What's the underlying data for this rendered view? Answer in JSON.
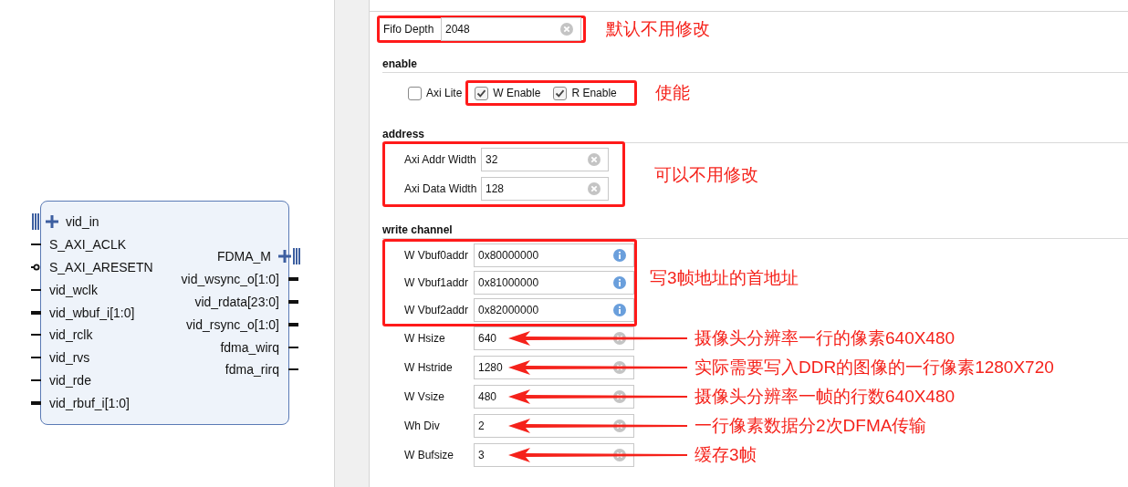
{
  "diagram": {
    "left_ports": [
      {
        "name": "vid_in",
        "kind": "interface"
      },
      {
        "name": "S_AXI_ACLK",
        "kind": "pin"
      },
      {
        "name": "S_AXI_ARESETN",
        "kind": "inverted"
      },
      {
        "name": "vid_wclk",
        "kind": "pin"
      },
      {
        "name": "vid_wbuf_i[1:0]",
        "kind": "bus"
      },
      {
        "name": "vid_rclk",
        "kind": "pin"
      },
      {
        "name": "vid_rvs",
        "kind": "pin"
      },
      {
        "name": "vid_rde",
        "kind": "pin"
      },
      {
        "name": "vid_rbuf_i[1:0]",
        "kind": "bus"
      }
    ],
    "right_ports": [
      {
        "name": "FDMA_M",
        "kind": "interface"
      },
      {
        "name": "vid_wsync_o[1:0]",
        "kind": "bus"
      },
      {
        "name": "vid_rdata[23:0]",
        "kind": "bus"
      },
      {
        "name": "vid_rsync_o[1:0]",
        "kind": "bus"
      },
      {
        "name": "fdma_wirq",
        "kind": "pin"
      },
      {
        "name": "fdma_rirq",
        "kind": "pin"
      }
    ]
  },
  "fifo": {
    "label": "Fifo Depth",
    "value": "2048",
    "kind": "clear",
    "note": "默认不用修改"
  },
  "enable": {
    "title": "enable",
    "checkboxes": [
      {
        "label": "Axi Lite",
        "checked": false
      }
    ],
    "outlined_checkboxes": [
      {
        "label": "W Enable",
        "checked": true
      },
      {
        "label": "R Enable",
        "checked": true
      }
    ],
    "note": "使能"
  },
  "address": {
    "title": "address",
    "fields": [
      {
        "label": "Axi Addr Width",
        "value": "32",
        "kind": "clear"
      },
      {
        "label": "Axi Data Width",
        "value": "128",
        "kind": "clear"
      }
    ],
    "note": "可以不用修改"
  },
  "write_channel": {
    "title": "write channel",
    "outlined_fields": [
      {
        "label": "W Vbuf0addr",
        "value": "0x80000000",
        "kind": "info"
      },
      {
        "label": "W Vbuf1addr",
        "value": "0x81000000",
        "kind": "info"
      },
      {
        "label": "W Vbuf2addr",
        "value": "0x82000000",
        "kind": "info"
      }
    ],
    "outlined_note": "写3帧地址的首地址",
    "fields": [
      {
        "label": "W Hsize",
        "value": "640",
        "kind": "clear",
        "note": "摄像头分辨率一行的像素640X480"
      },
      {
        "label": "W Hstride",
        "value": "1280",
        "kind": "clear",
        "note": "实际需要写入DDR的图像的一行像素1280X720"
      },
      {
        "label": "W Vsize",
        "value": "480",
        "kind": "clear",
        "note": "摄像头分辨率一帧的行数640X480"
      },
      {
        "label": "Wh Div",
        "value": "2",
        "kind": "clear",
        "note": "一行像素数据分2次DFMA传输"
      },
      {
        "label": "W Bufsize",
        "value": "3",
        "kind": "clear",
        "note": "缓存3帧"
      }
    ]
  }
}
